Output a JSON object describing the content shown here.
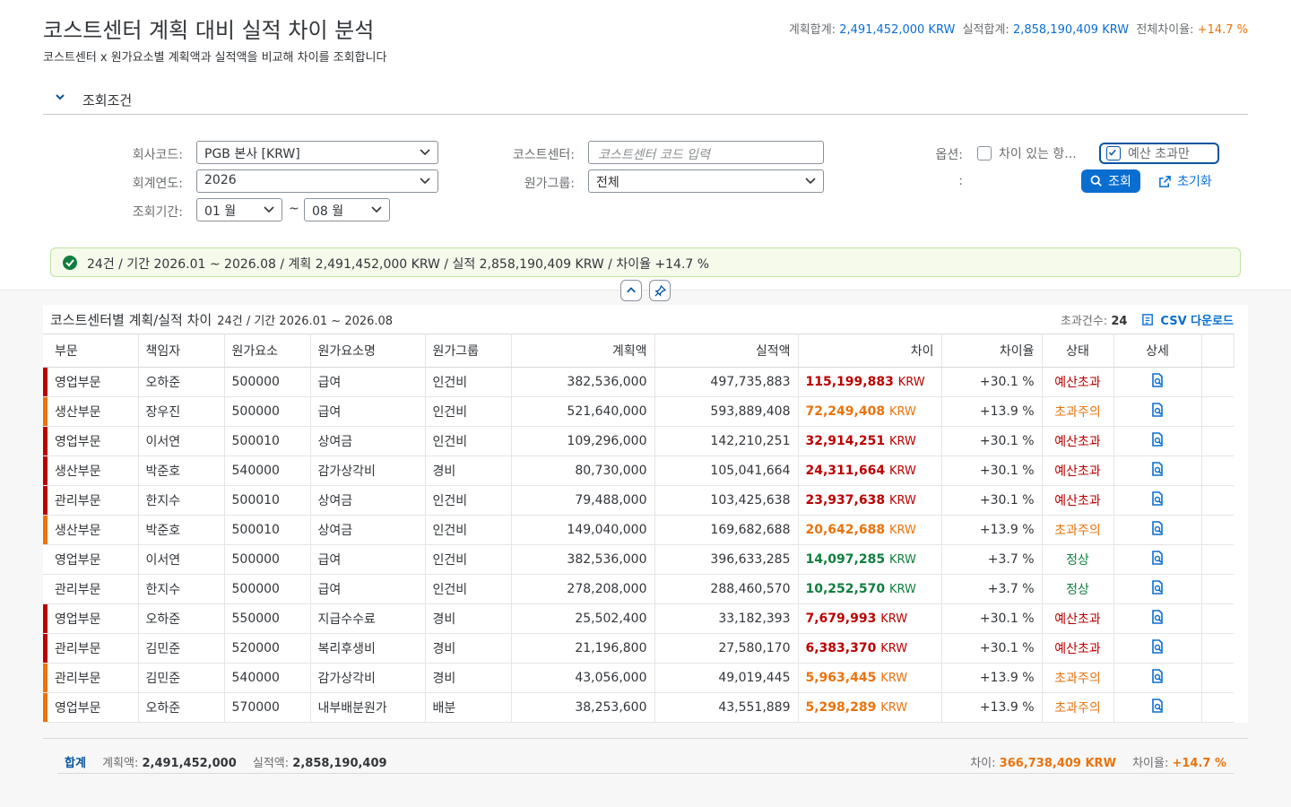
{
  "header": {
    "title": "코스트센터 계획 대비 실적 차이 분석",
    "subtitle": "코스트센터 x 원가요소별 계획액과 실적액을 비교해 차이를 조회합니다",
    "summary": {
      "plan_label": "계획합계:",
      "plan_value": "2,491,452,000 KRW",
      "actual_label": "실적합계:",
      "actual_value": "2,858,190,409 KRW",
      "rate_label": "전체차이율:",
      "rate_value": "+14.7 %"
    }
  },
  "filter": {
    "section_label": "조회조건",
    "company_label": "회사코드:",
    "company_value": "PGB 본사 [KRW]",
    "year_label": "회계연도:",
    "year_value": "2026",
    "period_label": "조회기간:",
    "period_from": "01 월",
    "period_sep": "~",
    "period_to": "08 월",
    "costcenter_label": "코스트센터:",
    "costcenter_placeholder": "코스트센터 코드 입력",
    "group_label": "원가그룹:",
    "group_value": "전체",
    "option_label": "옵션:",
    "option1": "차이 있는 항...",
    "option2": "예산 초과만",
    "colon_only": ":",
    "search_button": "조회",
    "reset_button": "초기화"
  },
  "message": "24건 / 기간 2026.01 ~ 2026.08 / 계획 2,491,452,000 KRW / 실적 2,858,190,409 KRW / 차이율 +14.7 %",
  "table": {
    "title": "코스트센터별 계획/실적 차이",
    "subtitle": "24건 / 기간 2026.01 ~ 2026.08",
    "over_label": "초과건수:",
    "over_value": "24",
    "csv_label": "CSV 다운로드",
    "columns": [
      "부문",
      "책임자",
      "원가요소",
      "원가요소명",
      "원가그룹",
      "계획액",
      "실적액",
      "차이",
      "차이율",
      "상태",
      "상세"
    ],
    "currency": "KRW",
    "rows": [
      {
        "dept": "영업부문",
        "owner": "오하준",
        "elem": "500000",
        "name": "급여",
        "group": "인건비",
        "plan": "382,536,000",
        "actual": "497,735,883",
        "diff": "115,199,883",
        "rate": "+30.1 %",
        "status": "예산초과",
        "level": "red"
      },
      {
        "dept": "생산부문",
        "owner": "장우진",
        "elem": "500000",
        "name": "급여",
        "group": "인건비",
        "plan": "521,640,000",
        "actual": "593,889,408",
        "diff": "72,249,408",
        "rate": "+13.9 %",
        "status": "초과주의",
        "level": "org"
      },
      {
        "dept": "영업부문",
        "owner": "이서연",
        "elem": "500010",
        "name": "상여금",
        "group": "인건비",
        "plan": "109,296,000",
        "actual": "142,210,251",
        "diff": "32,914,251",
        "rate": "+30.1 %",
        "status": "예산초과",
        "level": "red"
      },
      {
        "dept": "생산부문",
        "owner": "박준호",
        "elem": "540000",
        "name": "감가상각비",
        "group": "경비",
        "plan": "80,730,000",
        "actual": "105,041,664",
        "diff": "24,311,664",
        "rate": "+30.1 %",
        "status": "예산초과",
        "level": "red"
      },
      {
        "dept": "관리부문",
        "owner": "한지수",
        "elem": "500010",
        "name": "상여금",
        "group": "인건비",
        "plan": "79,488,000",
        "actual": "103,425,638",
        "diff": "23,937,638",
        "rate": "+30.1 %",
        "status": "예산초과",
        "level": "red"
      },
      {
        "dept": "생산부문",
        "owner": "박준호",
        "elem": "500010",
        "name": "상여금",
        "group": "인건비",
        "plan": "149,040,000",
        "actual": "169,682,688",
        "diff": "20,642,688",
        "rate": "+13.9 %",
        "status": "초과주의",
        "level": "org"
      },
      {
        "dept": "영업부문",
        "owner": "이서연",
        "elem": "500000",
        "name": "급여",
        "group": "인건비",
        "plan": "382,536,000",
        "actual": "396,633,285",
        "diff": "14,097,285",
        "rate": "+3.7 %",
        "status": "정상",
        "level": "grn"
      },
      {
        "dept": "관리부문",
        "owner": "한지수",
        "elem": "500000",
        "name": "급여",
        "group": "인건비",
        "plan": "278,208,000",
        "actual": "288,460,570",
        "diff": "10,252,570",
        "rate": "+3.7 %",
        "status": "정상",
        "level": "grn"
      },
      {
        "dept": "영업부문",
        "owner": "오하준",
        "elem": "550000",
        "name": "지급수수료",
        "group": "경비",
        "plan": "25,502,400",
        "actual": "33,182,393",
        "diff": "7,679,993",
        "rate": "+30.1 %",
        "status": "예산초과",
        "level": "red"
      },
      {
        "dept": "관리부문",
        "owner": "김민준",
        "elem": "520000",
        "name": "복리후생비",
        "group": "경비",
        "plan": "21,196,800",
        "actual": "27,580,170",
        "diff": "6,383,370",
        "rate": "+30.1 %",
        "status": "예산초과",
        "level": "red"
      },
      {
        "dept": "관리부문",
        "owner": "김민준",
        "elem": "540000",
        "name": "감가상각비",
        "group": "경비",
        "plan": "43,056,000",
        "actual": "49,019,445",
        "diff": "5,963,445",
        "rate": "+13.9 %",
        "status": "초과주의",
        "level": "org"
      },
      {
        "dept": "영업부문",
        "owner": "오하준",
        "elem": "570000",
        "name": "내부배분원가",
        "group": "배분",
        "plan": "38,253,600",
        "actual": "43,551,889",
        "diff": "5,298,289",
        "rate": "+13.9 %",
        "status": "초과주의",
        "level": "org"
      }
    ]
  },
  "footer": {
    "total_label": "합계",
    "plan_label": "계획액:",
    "plan_value": "2,491,452,000",
    "actual_label": "실적액:",
    "actual_value": "2,858,190,409",
    "diff_label": "차이:",
    "diff_value": "366,738,409 KRW",
    "rate_label": "차이율:",
    "rate_value": "+14.7 %"
  },
  "colors": {
    "red": "#bb0000",
    "org": "#e9730c",
    "grn": "#107e3e",
    "accent": "#0a6ed1"
  }
}
